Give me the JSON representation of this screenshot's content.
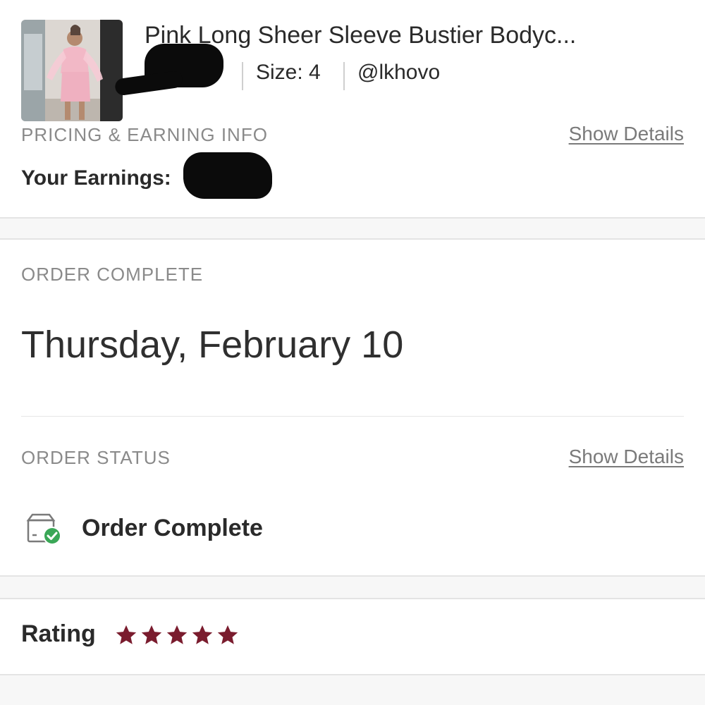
{
  "product": {
    "title": "Pink Long Sheer Sleeve Bustier Bodyc...",
    "price": "$",
    "size": "Size: 4",
    "seller": "@lkhovo"
  },
  "pricing": {
    "section_label": "PRICING & EARNING INFO",
    "show_details_label": "Show Details",
    "earnings_label": "Your Earnings:",
    "earnings_value": "$"
  },
  "order_complete": {
    "section_label": "ORDER COMPLETE",
    "date": "Thursday, February 10"
  },
  "order_status": {
    "section_label": "ORDER STATUS",
    "show_details_label": "Show Details",
    "status_text": "Order Complete",
    "icon": "package-check-icon"
  },
  "rating": {
    "label": "Rating",
    "stars": 5,
    "max_stars": 5,
    "star_color": "#7a1c2e"
  },
  "colors": {
    "accent": "#7a1c2e",
    "success": "#3aa757",
    "muted_text": "#8a8a8a"
  }
}
